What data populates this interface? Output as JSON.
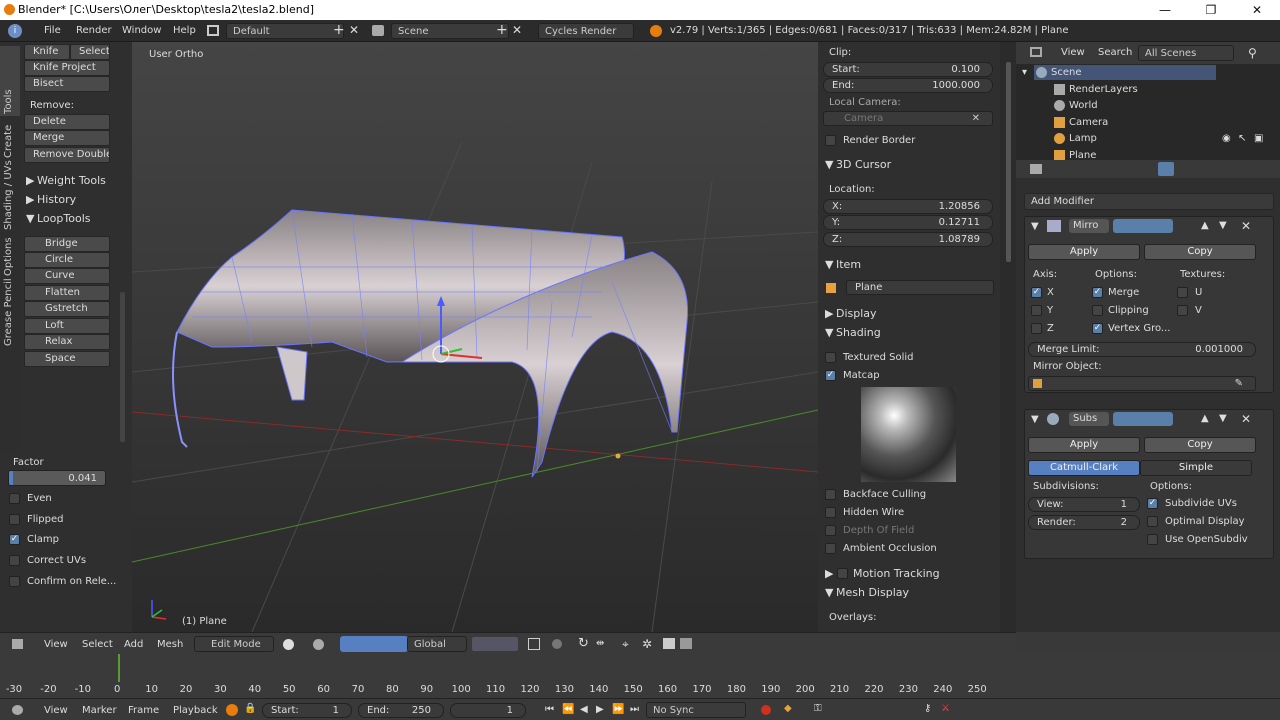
{
  "window": {
    "title": "Blender* [C:\\Users\\Олег\\Desktop\\tesla2\\tesla2.blend]",
    "minimize": "—",
    "maximize": "❐",
    "close": "✕"
  },
  "info": {
    "menus": [
      "File",
      "Render",
      "Window",
      "Help"
    ],
    "layout": "Default",
    "scene": "Scene",
    "engine": "Cycles Render",
    "stats": "v2.79 | Verts:1/365 | Edges:0/681 | Faces:0/317 | Tris:633 | Mem:24.82M | Plane"
  },
  "tabs": [
    "Tools",
    "Create",
    "Shading / UVs",
    "Options",
    "Grease Pencil"
  ],
  "tools": {
    "knife": "Knife",
    "select": "Select",
    "knife_project": "Knife Project",
    "bisect": "Bisect",
    "remove": "Remove:",
    "delete": "Delete",
    "merge": "Merge",
    "remove_doubles": "Remove Doubles",
    "weight_tools": "Weight Tools",
    "history": "History",
    "looptools": "LoopTools",
    "loop_items": [
      "Bridge",
      "Circle",
      "Curve",
      "Flatten",
      "Gstretch",
      "Loft",
      "Relax",
      "Space"
    ]
  },
  "operator": {
    "factor_label": "Factor",
    "factor_value": "0.041",
    "factor_fill": 0.041,
    "options": [
      {
        "label": "Even",
        "on": false
      },
      {
        "label": "Flipped",
        "on": false
      },
      {
        "label": "Clamp",
        "on": true
      },
      {
        "label": "Correct UVs",
        "on": false
      },
      {
        "label": "Confirm on Rele...",
        "on": false
      }
    ]
  },
  "viewport": {
    "view_name": "User Ortho",
    "object_name": "(1) Plane"
  },
  "npanel": {
    "clip": "Clip:",
    "start_label": "Start:",
    "start_value": "0.100",
    "end_label": "End:",
    "end_value": "1000.000",
    "local_camera": "Local Camera:",
    "camera_placeholder": "Camera",
    "render_border": "Render Border",
    "cursor_header": "3D Cursor",
    "location": "Location:",
    "x_label": "X:",
    "x_value": "1.20856",
    "y_label": "Y:",
    "y_value": "0.12711",
    "z_label": "Z:",
    "z_value": "1.08789",
    "item_header": "Item",
    "item_name": "Plane",
    "display_header": "Display",
    "shading_header": "Shading",
    "textured_solid": "Textured Solid",
    "matcap": "Matcap",
    "backface": "Backface Culling",
    "hidden_wire": "Hidden Wire",
    "dof": "Depth Of Field",
    "ao": "Ambient Occlusion",
    "motion_tracking": "Motion Tracking",
    "mesh_display": "Mesh Display",
    "overlays": "Overlays:"
  },
  "outliner": {
    "view": "View",
    "search": "Search",
    "filter": "All Scenes",
    "items": [
      "Scene",
      "RenderLayers",
      "World",
      "Camera",
      "Lamp",
      "Plane"
    ]
  },
  "props": {
    "add_modifier": "Add Modifier",
    "mirror": {
      "name": "Mirro",
      "apply": "Apply",
      "copy": "Copy",
      "axis": "Axis:",
      "options": "Options:",
      "textures": "Textures:",
      "x": "X",
      "y": "Y",
      "z": "Z",
      "merge": "Merge",
      "clipping": "Clipping",
      "vertex_groups": "Vertex Gro...",
      "u": "U",
      "v": "V",
      "merge_limit_label": "Merge Limit:",
      "merge_limit_value": "0.001000",
      "mirror_object": "Mirror Object:"
    },
    "subsurf": {
      "name": "Subs",
      "apply": "Apply",
      "copy": "Copy",
      "catmull": "Catmull-Clark",
      "simple": "Simple",
      "subdivisions": "Subdivisions:",
      "options": "Options:",
      "view_label": "View:",
      "view_value": "1",
      "render_label": "Render:",
      "render_value": "2",
      "subdivide_uvs": "Subdivide UVs",
      "optimal_display": "Optimal Display",
      "use_opensubdiv": "Use OpenSubdiv"
    }
  },
  "view_header": {
    "view": "View",
    "select": "Select",
    "add": "Add",
    "mesh": "Mesh",
    "mode": "Edit Mode",
    "orientation": "Global"
  },
  "timeline": {
    "ticks": [
      "-30",
      "-20",
      "-10",
      "0",
      "10",
      "20",
      "30",
      "40",
      "50",
      "60",
      "70",
      "80",
      "90",
      "100",
      "110",
      "120",
      "130",
      "140",
      "150",
      "160",
      "170",
      "180",
      "190",
      "200",
      "210",
      "220",
      "230",
      "240",
      "250"
    ],
    "view": "View",
    "marker": "Marker",
    "frame": "Frame",
    "playback": "Playback",
    "start_label": "Start:",
    "start_value": "1",
    "end_label": "End:",
    "end_value": "250",
    "current": "1",
    "sync": "No Sync"
  },
  "colors": {
    "accent": "#5680c2",
    "x_axis": "#a03030",
    "y_axis": "#5a9a30"
  }
}
